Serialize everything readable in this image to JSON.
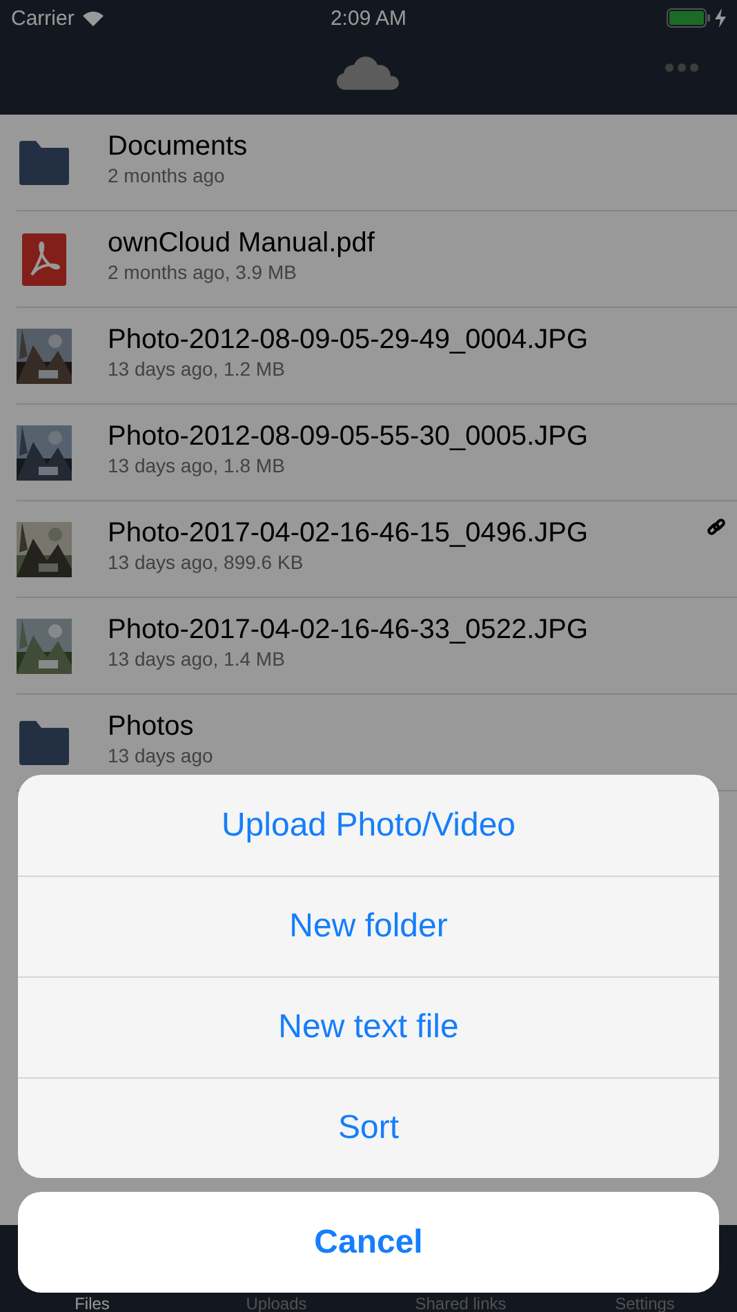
{
  "status_bar": {
    "carrier": "Carrier",
    "time": "2:09 AM",
    "charging": true
  },
  "files": [
    {
      "kind": "folder",
      "name": "Documents",
      "detail": "2 months ago",
      "shared": false
    },
    {
      "kind": "pdf",
      "name": "ownCloud Manual.pdf",
      "detail": "2 months ago, 3.9 MB",
      "shared": false
    },
    {
      "kind": "picture",
      "name": "Photo-2012-08-09-05-29-49_0004.JPG",
      "detail": "13 days ago, 1.2 MB",
      "shared": false
    },
    {
      "kind": "picture",
      "name": "Photo-2012-08-09-05-55-30_0005.JPG",
      "detail": "13 days ago, 1.8 MB",
      "shared": false
    },
    {
      "kind": "picture",
      "name": "Photo-2017-04-02-16-46-15_0496.JPG",
      "detail": "13 days ago, 899.6 KB",
      "shared": true
    },
    {
      "kind": "picture",
      "name": "Photo-2017-04-02-16-46-33_0522.JPG",
      "detail": "13 days ago, 1.4 MB",
      "shared": false
    },
    {
      "kind": "folder",
      "name": "Photos",
      "detail": "13 days ago",
      "shared": false
    }
  ],
  "tabs": [
    {
      "label": "Files",
      "selected": true
    },
    {
      "label": "Uploads",
      "selected": false
    },
    {
      "label": "Shared links",
      "selected": false
    },
    {
      "label": "Settings",
      "selected": false
    }
  ],
  "action_sheet": {
    "actions": [
      "Upload Photo/Video",
      "New folder",
      "New text file",
      "Sort"
    ],
    "cancel": "Cancel"
  }
}
